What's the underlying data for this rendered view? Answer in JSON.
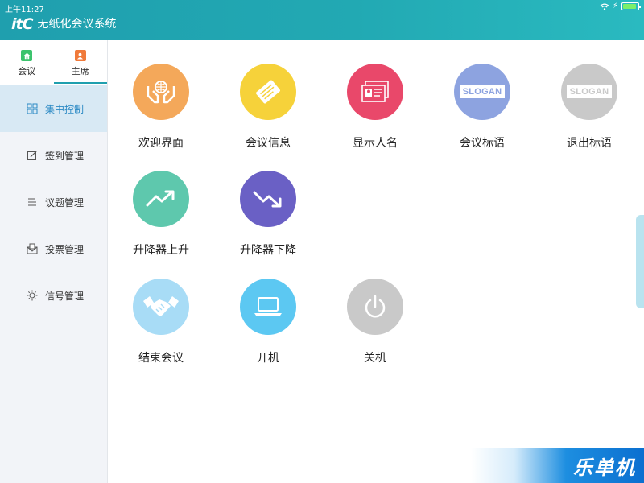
{
  "status": {
    "time": "上午11:27",
    "battery_fraction": 0.9
  },
  "app": {
    "logo": "itC",
    "title": "无纸化会议系统"
  },
  "roles": [
    {
      "label": "会议",
      "icon": "home-icon",
      "color": "#3cc36d"
    },
    {
      "label": "主席",
      "icon": "person-icon",
      "color": "#f07a3a"
    }
  ],
  "active_role": "主席",
  "nav": [
    {
      "label": "集中控制",
      "icon": "grid-icon",
      "active": true
    },
    {
      "label": "签到管理",
      "icon": "sign-in-icon",
      "active": false
    },
    {
      "label": "议题管理",
      "icon": "list-icon",
      "active": false
    },
    {
      "label": "投票管理",
      "icon": "ballot-icon",
      "active": false
    },
    {
      "label": "信号管理",
      "icon": "signal-icon",
      "active": false
    }
  ],
  "tiles": [
    {
      "label": "欢迎界面",
      "icon": "welcome-hands-icon",
      "color": "#f4a85a"
    },
    {
      "label": "会议信息",
      "icon": "meeting-info-icon",
      "color": "#f6d23a"
    },
    {
      "label": "显示人名",
      "icon": "name-card-icon",
      "color": "#e9486a"
    },
    {
      "label": "会议标语",
      "icon": "slogan-icon",
      "color": "#8da3e0",
      "slogan_text": "SLOGAN"
    },
    {
      "label": "退出标语",
      "icon": "slogan-icon",
      "color": "#c9c9c9",
      "slogan_text": "SLOGAN"
    },
    {
      "label": "升降器上升",
      "icon": "trend-up-icon",
      "color": "#5ec8ad"
    },
    {
      "label": "升降器下降",
      "icon": "trend-down-icon",
      "color": "#6a60c5"
    },
    {
      "label": "结束会议",
      "icon": "handshake-icon",
      "color": "#a8dcf6"
    },
    {
      "label": "开机",
      "icon": "laptop-icon",
      "color": "#5cc8f2"
    },
    {
      "label": "关机",
      "icon": "power-icon",
      "color": "#c9c9c9"
    }
  ],
  "watermark": {
    "text": "乐单机"
  }
}
